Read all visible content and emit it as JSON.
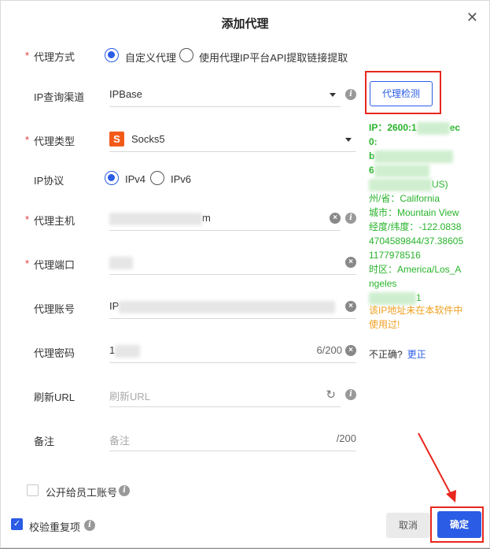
{
  "dialog": {
    "title": "添加代理"
  },
  "icons": {
    "close": "close-icon",
    "info": "info-icon",
    "caret": "caret-down-icon",
    "clear": "clear-icon",
    "refresh": "refresh-icon",
    "socks": "socks-icon"
  },
  "colors": {
    "primary": "#2b5ce6",
    "success": "#28b42b",
    "warning": "#f0a020",
    "required": "#e23c39",
    "highlight": "#e8271d",
    "socks": "#f25a1a"
  },
  "form": {
    "proxy_mode": {
      "label": "代理方式",
      "options": [
        "自定义代理",
        "使用代理IP平台API提取链接提取"
      ],
      "selected": 0
    },
    "ip_channel": {
      "label": "IP查询渠道",
      "value": "IPBase"
    },
    "proxy_type": {
      "label": "代理类型",
      "icon_text": "S",
      "value": "Socks5"
    },
    "ip_protocol": {
      "label": "IP协议",
      "options": [
        "IPv4",
        "IPv6"
      ],
      "selected": 0
    },
    "host": {
      "label": "代理主机",
      "value_tail": "m"
    },
    "port": {
      "label": "代理端口"
    },
    "account": {
      "label": "代理账号",
      "value_head": "IP"
    },
    "password": {
      "label": "代理密码",
      "value_head": "1",
      "counter": "6/200"
    },
    "refresh_url": {
      "label": "刷新URL",
      "placeholder": "刷新URL"
    },
    "remark": {
      "label": "备注",
      "placeholder": "备注",
      "counter": "/200"
    }
  },
  "check": {
    "button_label": "代理检测",
    "result": {
      "ip_line": "IP：2600:1",
      "ip_frag": "ec0:",
      "ip_line2": "b",
      "ip_line3": "6",
      "country_tail": "US)",
      "state": "州/省：California",
      "city": "城市：Mountain View",
      "coords": "经度/纬度：-122.08384704589844/37.386051177978516",
      "timezone": "时区：America/Los_Angeles",
      "zip_tail": "1"
    },
    "warning": "该IP地址未在本软件中使用过!",
    "incorrect_label": "不正确?",
    "fix_label": "更正"
  },
  "options": {
    "share_label": "公开给员工账号",
    "share_checked": false,
    "dedupe_label": "校验重复项",
    "dedupe_checked": true
  },
  "footer": {
    "cancel": "取消",
    "ok": "确定"
  }
}
